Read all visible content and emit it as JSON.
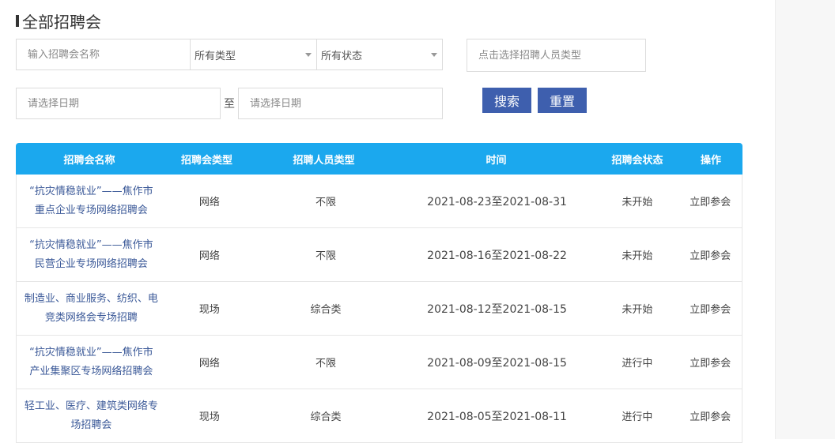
{
  "page": {
    "title": "全部招聘会"
  },
  "filters": {
    "name_placeholder": "输入招聘会名称",
    "type_select": "所有类型",
    "status_select": "所有状态",
    "personnel_placeholder": "点击选择招聘人员类型",
    "start_date_placeholder": "请选择日期",
    "to_label": "至",
    "end_date_placeholder": "请选择日期",
    "search_label": "搜索",
    "reset_label": "重置"
  },
  "table": {
    "headers": [
      "招聘会名称",
      "招聘会类型",
      "招聘人员类型",
      "时间",
      "招聘会状态",
      "操作"
    ],
    "rows": [
      {
        "name_line1": "“抗灾情稳就业”——焦作市",
        "name_line2": "重点企业专场网络招聘会",
        "type": "网络",
        "personnel": "不限",
        "time": "2021-08-23至2021-08-31",
        "status": "未开始",
        "action": "立即参会"
      },
      {
        "name_line1": "“抗灾情稳就业”——焦作市",
        "name_line2": "民营企业专场网络招聘会",
        "type": "网络",
        "personnel": "不限",
        "time": "2021-08-16至2021-08-22",
        "status": "未开始",
        "action": "立即参会"
      },
      {
        "name_line1": "制造业、商业服务、纺织、电",
        "name_line2": "竞类网络会专场招聘",
        "type": "现场",
        "personnel": "综合类",
        "time": "2021-08-12至2021-08-15",
        "status": "未开始",
        "action": "立即参会"
      },
      {
        "name_line1": "“抗灾情稳就业”——焦作市",
        "name_line2": "产业集聚区专场网络招聘会",
        "type": "网络",
        "personnel": "不限",
        "time": "2021-08-09至2021-08-15",
        "status": "进行中",
        "action": "立即参会"
      },
      {
        "name_line1": "轻工业、医疗、建筑类网络专",
        "name_line2": "场招聘会",
        "type": "现场",
        "personnel": "综合类",
        "time": "2021-08-05至2021-08-11",
        "status": "进行中",
        "action": "立即参会"
      }
    ]
  },
  "colors": {
    "accent": "#1ba8ee",
    "button": "#3e5fae",
    "link": "#3b5998"
  }
}
